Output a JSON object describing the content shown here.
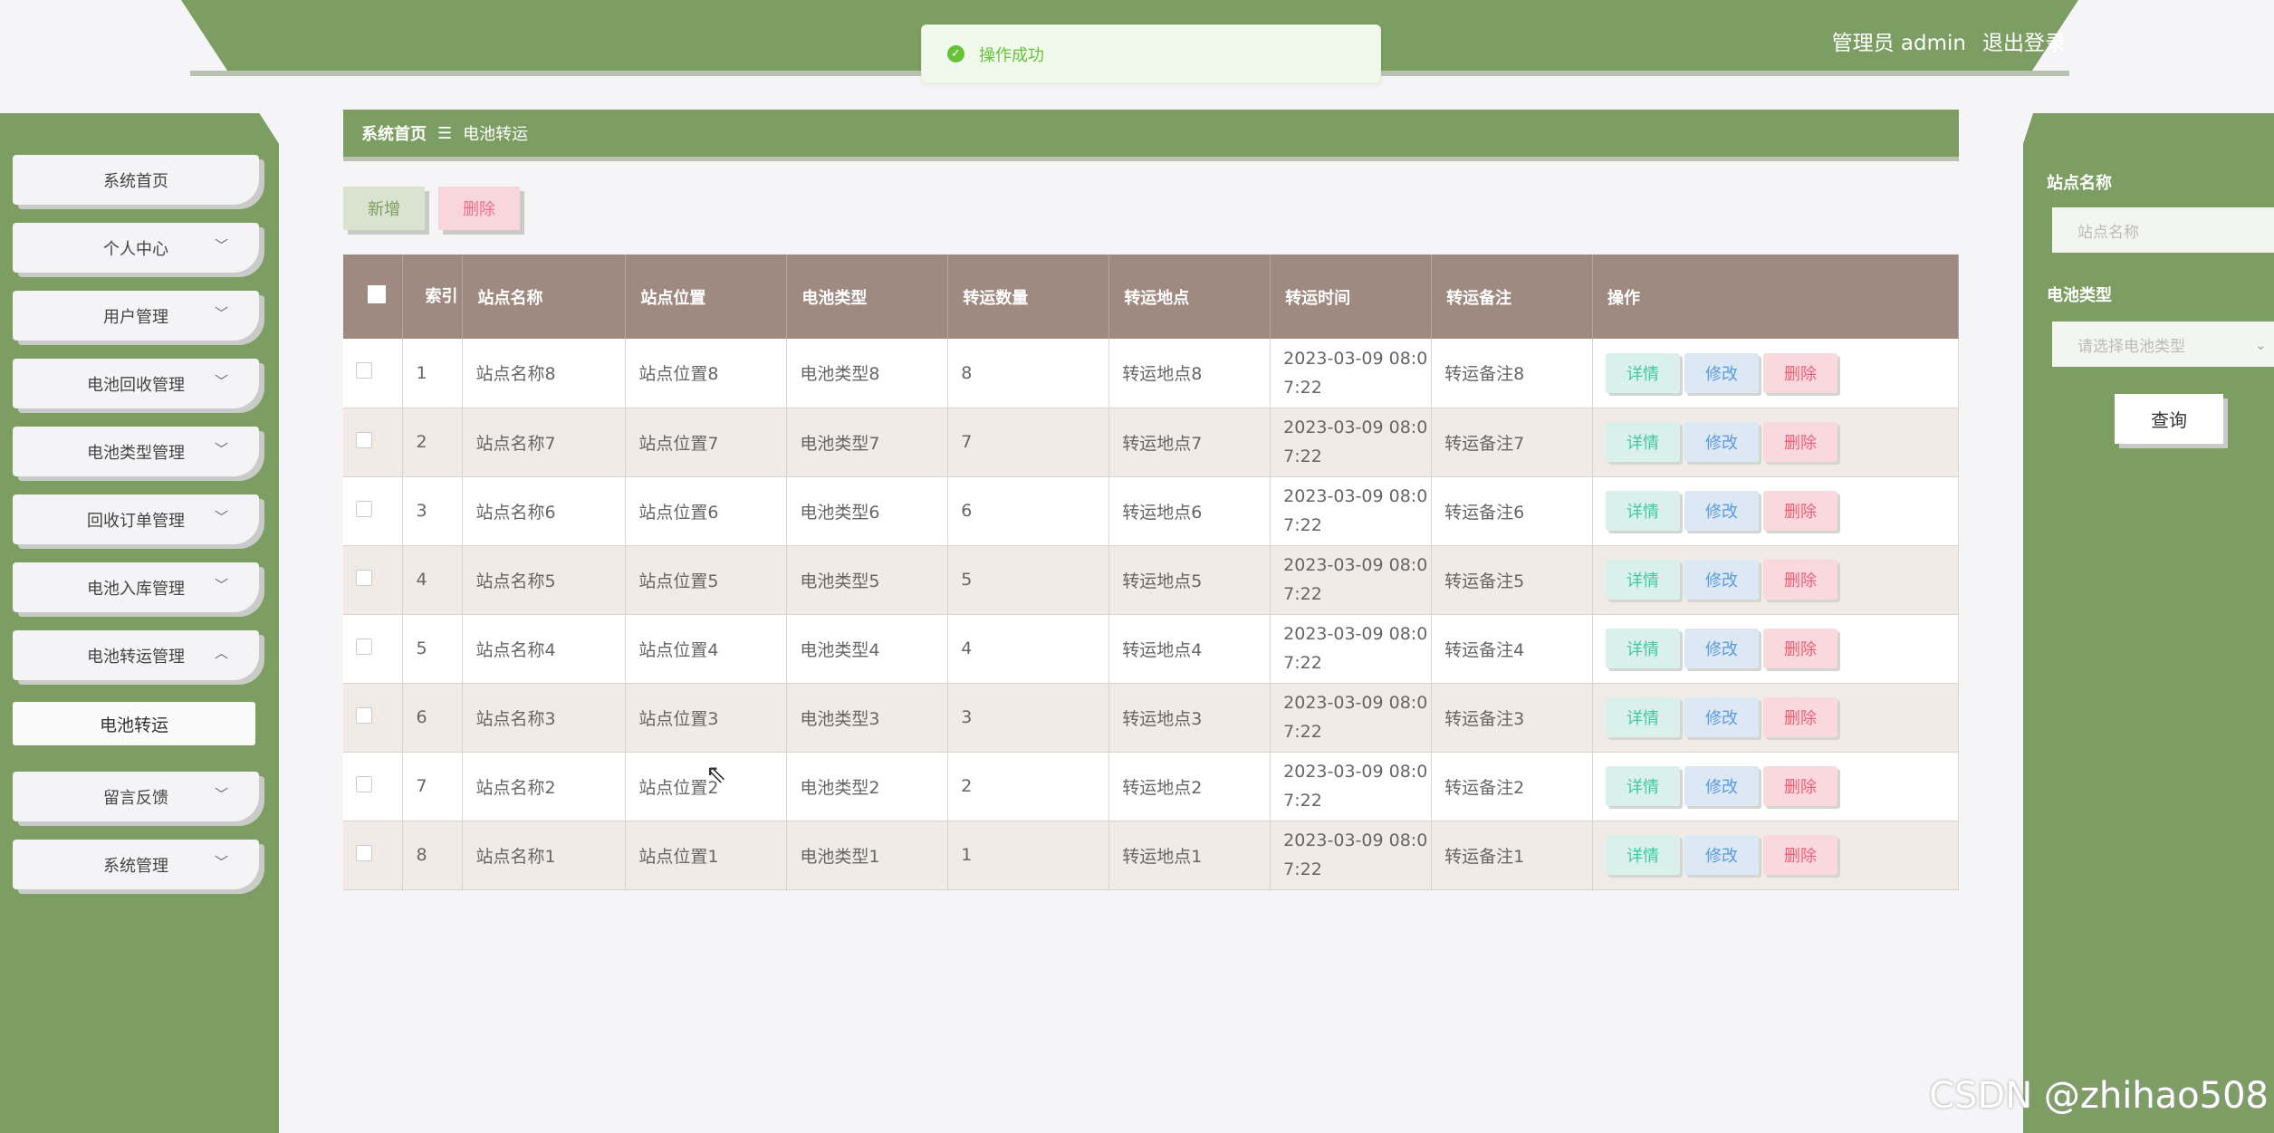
{
  "header": {
    "user_label": "管理员 admin",
    "logout_label": "退出登录"
  },
  "toast": {
    "message": "操作成功"
  },
  "sidebar": {
    "items": [
      {
        "label": "系统首页",
        "has_chevron": false
      },
      {
        "label": "个人中心",
        "has_chevron": true
      },
      {
        "label": "用户管理",
        "has_chevron": true
      },
      {
        "label": "电池回收管理",
        "has_chevron": true
      },
      {
        "label": "电池类型管理",
        "has_chevron": true
      },
      {
        "label": "回收订单管理",
        "has_chevron": true
      },
      {
        "label": "电池入库管理",
        "has_chevron": true
      },
      {
        "label": "电池转运管理",
        "has_chevron": true,
        "expanded": true
      },
      {
        "label": "留言反馈",
        "has_chevron": true
      },
      {
        "label": "系统管理",
        "has_chevron": true
      }
    ],
    "sub_item": "电池转运"
  },
  "breadcrumb": {
    "home": "系统首页",
    "separator": "☰",
    "current": "电池转运"
  },
  "toolbar": {
    "add_label": "新增",
    "delete_label": "删除"
  },
  "filter": {
    "station_label": "站点名称",
    "station_placeholder": "站点名称",
    "battery_label": "电池类型",
    "battery_placeholder": "请选择电池类型",
    "query_label": "查询"
  },
  "table": {
    "headers": [
      "索引",
      "站点名称",
      "站点位置",
      "电池类型",
      "转运数量",
      "转运地点",
      "转运时间",
      "转运备注",
      "操作"
    ],
    "rows": [
      {
        "idx": "1",
        "name": "站点名称8",
        "loc": "站点位置8",
        "type": "电池类型8",
        "qty": "8",
        "dest": "转运地点8",
        "time1": "2023-03-09 08:0",
        "time2": "7:22",
        "note": "转运备注8"
      },
      {
        "idx": "2",
        "name": "站点名称7",
        "loc": "站点位置7",
        "type": "电池类型7",
        "qty": "7",
        "dest": "转运地点7",
        "time1": "2023-03-09 08:0",
        "time2": "7:22",
        "note": "转运备注7"
      },
      {
        "idx": "3",
        "name": "站点名称6",
        "loc": "站点位置6",
        "type": "电池类型6",
        "qty": "6",
        "dest": "转运地点6",
        "time1": "2023-03-09 08:0",
        "time2": "7:22",
        "note": "转运备注6"
      },
      {
        "idx": "4",
        "name": "站点名称5",
        "loc": "站点位置5",
        "type": "电池类型5",
        "qty": "5",
        "dest": "转运地点5",
        "time1": "2023-03-09 08:0",
        "time2": "7:22",
        "note": "转运备注5"
      },
      {
        "idx": "5",
        "name": "站点名称4",
        "loc": "站点位置4",
        "type": "电池类型4",
        "qty": "4",
        "dest": "转运地点4",
        "time1": "2023-03-09 08:0",
        "time2": "7:22",
        "note": "转运备注4"
      },
      {
        "idx": "6",
        "name": "站点名称3",
        "loc": "站点位置3",
        "type": "电池类型3",
        "qty": "3",
        "dest": "转运地点3",
        "time1": "2023-03-09 08:0",
        "time2": "7:22",
        "note": "转运备注3"
      },
      {
        "idx": "7",
        "name": "站点名称2",
        "loc": "站点位置2",
        "type": "电池类型2",
        "qty": "2",
        "dest": "转运地点2",
        "time1": "2023-03-09 08:0",
        "time2": "7:22",
        "note": "转运备注2"
      },
      {
        "idx": "8",
        "name": "站点名称1",
        "loc": "站点位置1",
        "type": "电池类型1",
        "qty": "1",
        "dest": "转运地点1",
        "time1": "2023-03-09 08:0",
        "time2": "7:22",
        "note": "转运备注1"
      }
    ],
    "ops": {
      "detail": "详情",
      "edit": "修改",
      "delete": "删除"
    }
  },
  "watermark": "CSDN @zhihao508",
  "colors": {
    "accent": "#7c9e62",
    "table_header": "#9e8a80"
  }
}
